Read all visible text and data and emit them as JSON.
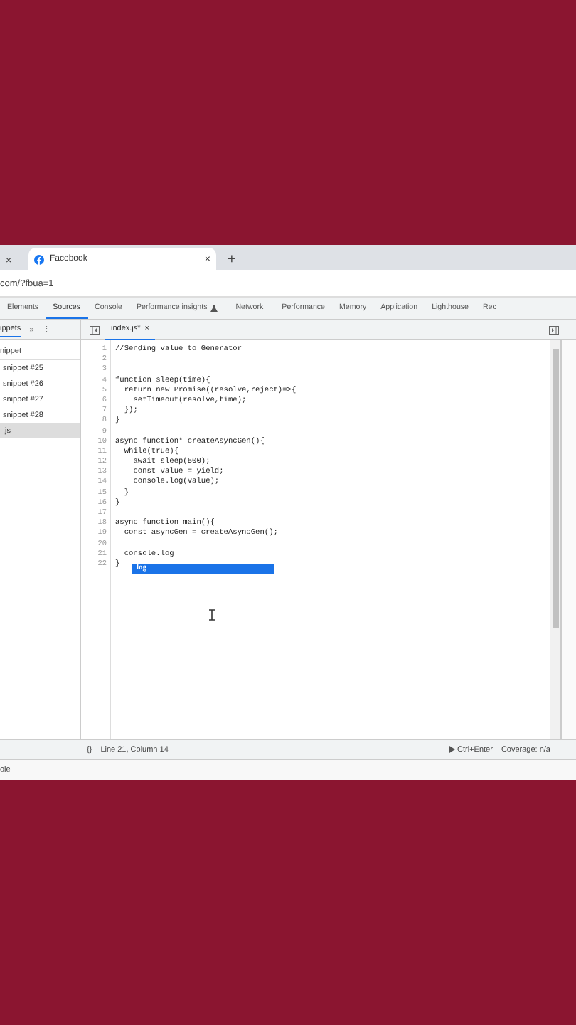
{
  "browser_tabs": [
    {
      "selected": false,
      "close": "×"
    },
    {
      "title": "Facebook",
      "selected": true,
      "close": "×"
    }
  ],
  "new_tab": "+",
  "address": "com/?fbua=1",
  "devtools_tabs": [
    {
      "label": "Elements",
      "selected": false
    },
    {
      "label": "Sources",
      "selected": true
    },
    {
      "label": "Console",
      "selected": false
    },
    {
      "label": "Performance insights",
      "selected": false,
      "kind": "flask"
    },
    {
      "label": "Network",
      "selected": false
    },
    {
      "label": "Performance",
      "selected": false
    },
    {
      "label": "Memory",
      "selected": false
    },
    {
      "label": "Application",
      "selected": false
    },
    {
      "label": "Lighthouse",
      "selected": false
    },
    {
      "label": "Rec",
      "selected": false
    }
  ],
  "navigator": {
    "tab": "ippets",
    "more": "»",
    "menu": "⋮",
    "items": [
      {
        "label": "nippet",
        "selected": false
      },
      {
        "label": "snippet #25",
        "selected": false
      },
      {
        "label": "snippet #26",
        "selected": false
      },
      {
        "label": "snippet #27",
        "selected": false
      },
      {
        "label": "snippet #28",
        "selected": false
      },
      {
        "label": ".js",
        "selected": true
      }
    ]
  },
  "editor_tab": {
    "label": "index.js*",
    "close": "×"
  },
  "code": [
    {
      "number": "1",
      "text": "//Sending value to Generator"
    },
    {
      "number": "2"
    },
    {
      "number": "3"
    },
    {
      "number": "4",
      "text": "function sleep(time){"
    },
    {
      "number": "5",
      "text": "  return new Promise((resolve,reject)=>{"
    },
    {
      "number": "6",
      "text": "    setTimeout(resolve,time);"
    },
    {
      "number": "7",
      "text": "  });"
    },
    {
      "number": "8",
      "text": "}"
    },
    {
      "number": "9"
    },
    {
      "number": "10",
      "text": "async function* createAsyncGen(){"
    },
    {
      "number": "11",
      "text": "  while(true){"
    },
    {
      "number": "12",
      "text": "    await sleep(500);"
    },
    {
      "number": "13",
      "text": "    const value = yield;"
    },
    {
      "number": "14",
      "text": "    console.log(value);"
    },
    {
      "number": "15",
      "text": "  }"
    },
    {
      "number": "16",
      "text": "}"
    },
    {
      "number": "17"
    },
    {
      "number": "18",
      "text": "async function main(){"
    },
    {
      "number": "19",
      "text": "  const asyncGen = createAsyncGen();"
    },
    {
      "number": "20"
    },
    {
      "number": "21",
      "text": "  console.log"
    },
    {
      "number": "22",
      "text": "}"
    }
  ],
  "autocomplete": [
    {
      "label": "log",
      "selected": true
    }
  ],
  "status_bar": {
    "format": "{}",
    "position": "Line 21, Column 14",
    "run": "Ctrl+Enter",
    "coverage": "Coverage: n/a"
  },
  "drawer_tab": "ole"
}
